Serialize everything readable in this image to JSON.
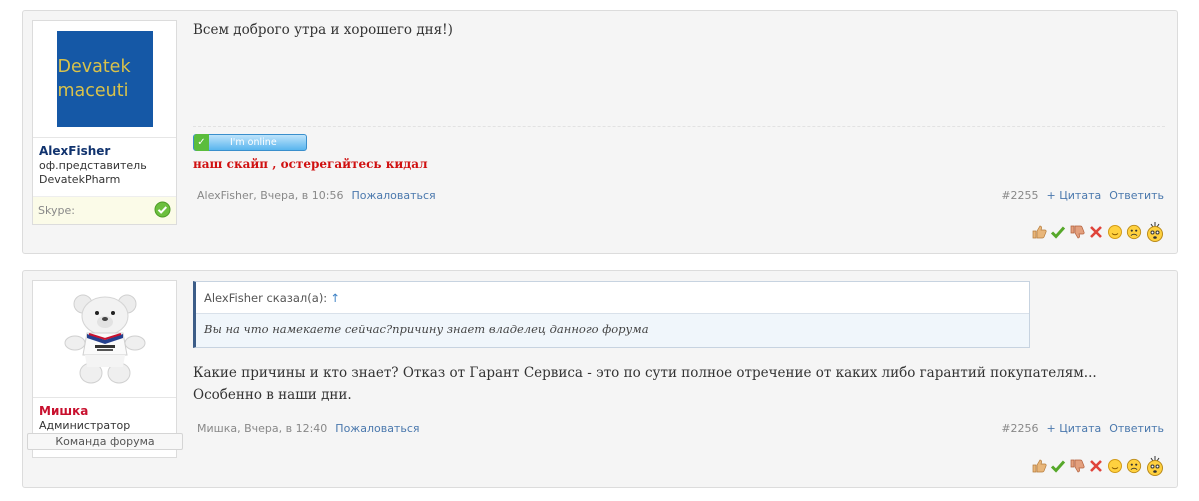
{
  "posts": [
    {
      "author": "AlexFisher",
      "title_line1": "оф.представитель",
      "title_line2": "DevatekPharm",
      "avatar_text_line1": "Devatek",
      "avatar_text_line2": "maceuti",
      "skype_label": "Skype:",
      "message": "Всем доброго утра и хорошего дня!)",
      "online_badge": "I'm online",
      "signature": "наш скайп , остерегайтесь кидал",
      "meta_author_time": "AlexFisher, Вчера, в 10:56",
      "report_label": "Пожаловаться",
      "post_number": "#2255",
      "quote_label": "+ Цитата",
      "reply_label": "Ответить"
    },
    {
      "author": "Мишка",
      "title_line1": "Администратор",
      "team_badge": "Команда форума",
      "quote_author": "AlexFisher сказал(а):",
      "quote_up_arrow": "↑",
      "quote_text": "Вы на что намекаете сейчас?причину знает владелец данного форума",
      "message": "Какие причины и кто знает? Отказ от Гарант Сервиса - это по сути полное отречение от каких либо гарантий покупателям... Особенно в наши дни.",
      "meta_author_time": "Мишка, Вчера, в 12:40",
      "report_label": "Пожаловаться",
      "post_number": "#2256",
      "quote_label": "+ Цитата",
      "reply_label": "Ответить"
    }
  ],
  "reaction_icons": [
    "thumbs-up-icon",
    "check-icon",
    "thumbs-down-icon",
    "cross-icon",
    "smile-icon",
    "sad-icon",
    "shocked-icon"
  ],
  "colors": {
    "author_blue": "#11336e",
    "author_red": "#c8102e",
    "link": "#4a78ad",
    "signature_red": "#d01010"
  }
}
